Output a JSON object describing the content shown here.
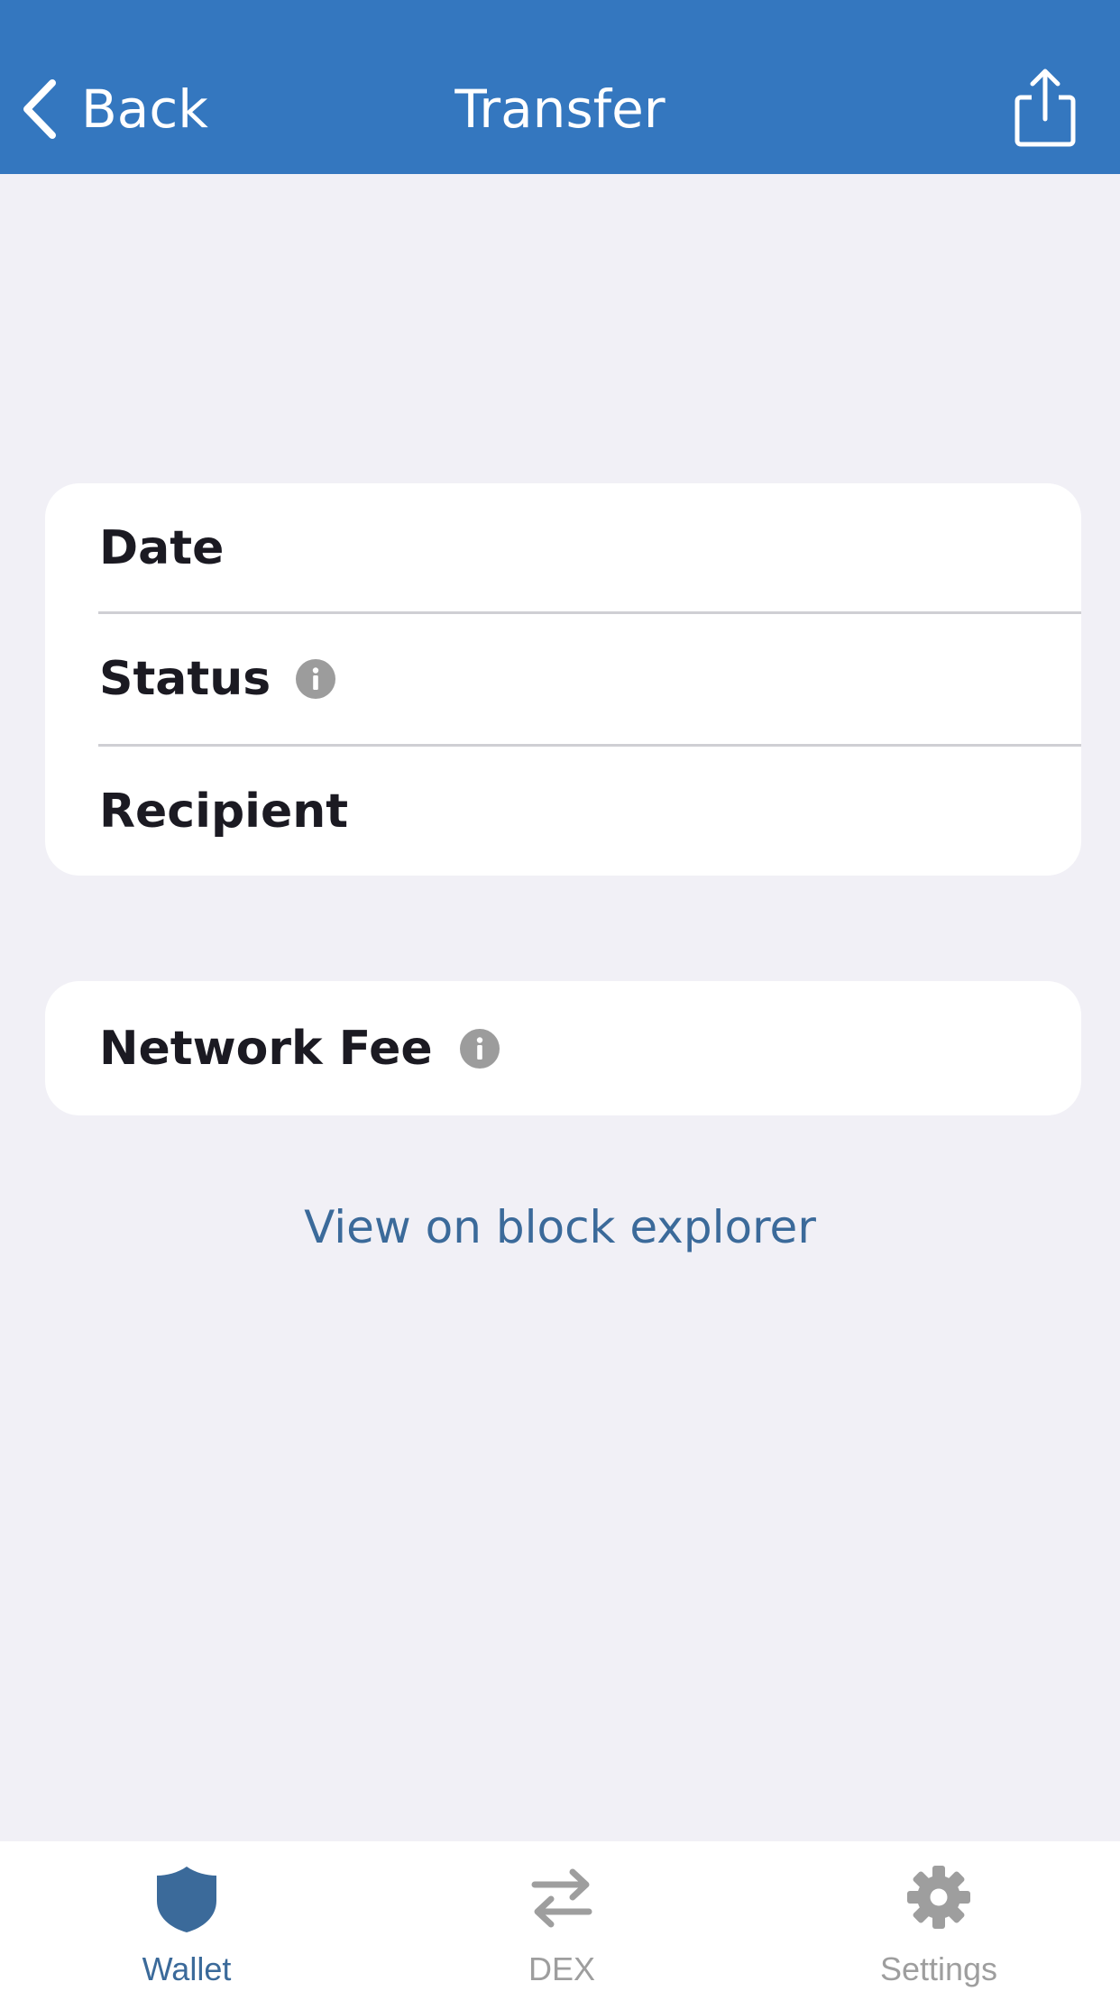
{
  "nav": {
    "back_label": "Back",
    "title": "Transfer",
    "back_icon": "chevron-left-icon",
    "share_icon": "share-icon",
    "bar_color": "#3477bf"
  },
  "details_card": {
    "rows": [
      {
        "label": "Date",
        "has_info": false
      },
      {
        "label": "Status",
        "has_info": true
      },
      {
        "label": "Recipient",
        "has_info": false
      }
    ]
  },
  "fee_card": {
    "label": "Network Fee",
    "has_info": true
  },
  "explorer_link": "View on block explorer",
  "tabbar": {
    "tabs": [
      {
        "label": "Wallet",
        "icon": "shield-icon",
        "active": true
      },
      {
        "label": "DEX",
        "icon": "swap-arrows-icon",
        "active": false
      },
      {
        "label": "Settings",
        "icon": "gear-icon",
        "active": false
      }
    ],
    "active_color": "#3b6a9a",
    "inactive_color": "#9e9e9e"
  }
}
